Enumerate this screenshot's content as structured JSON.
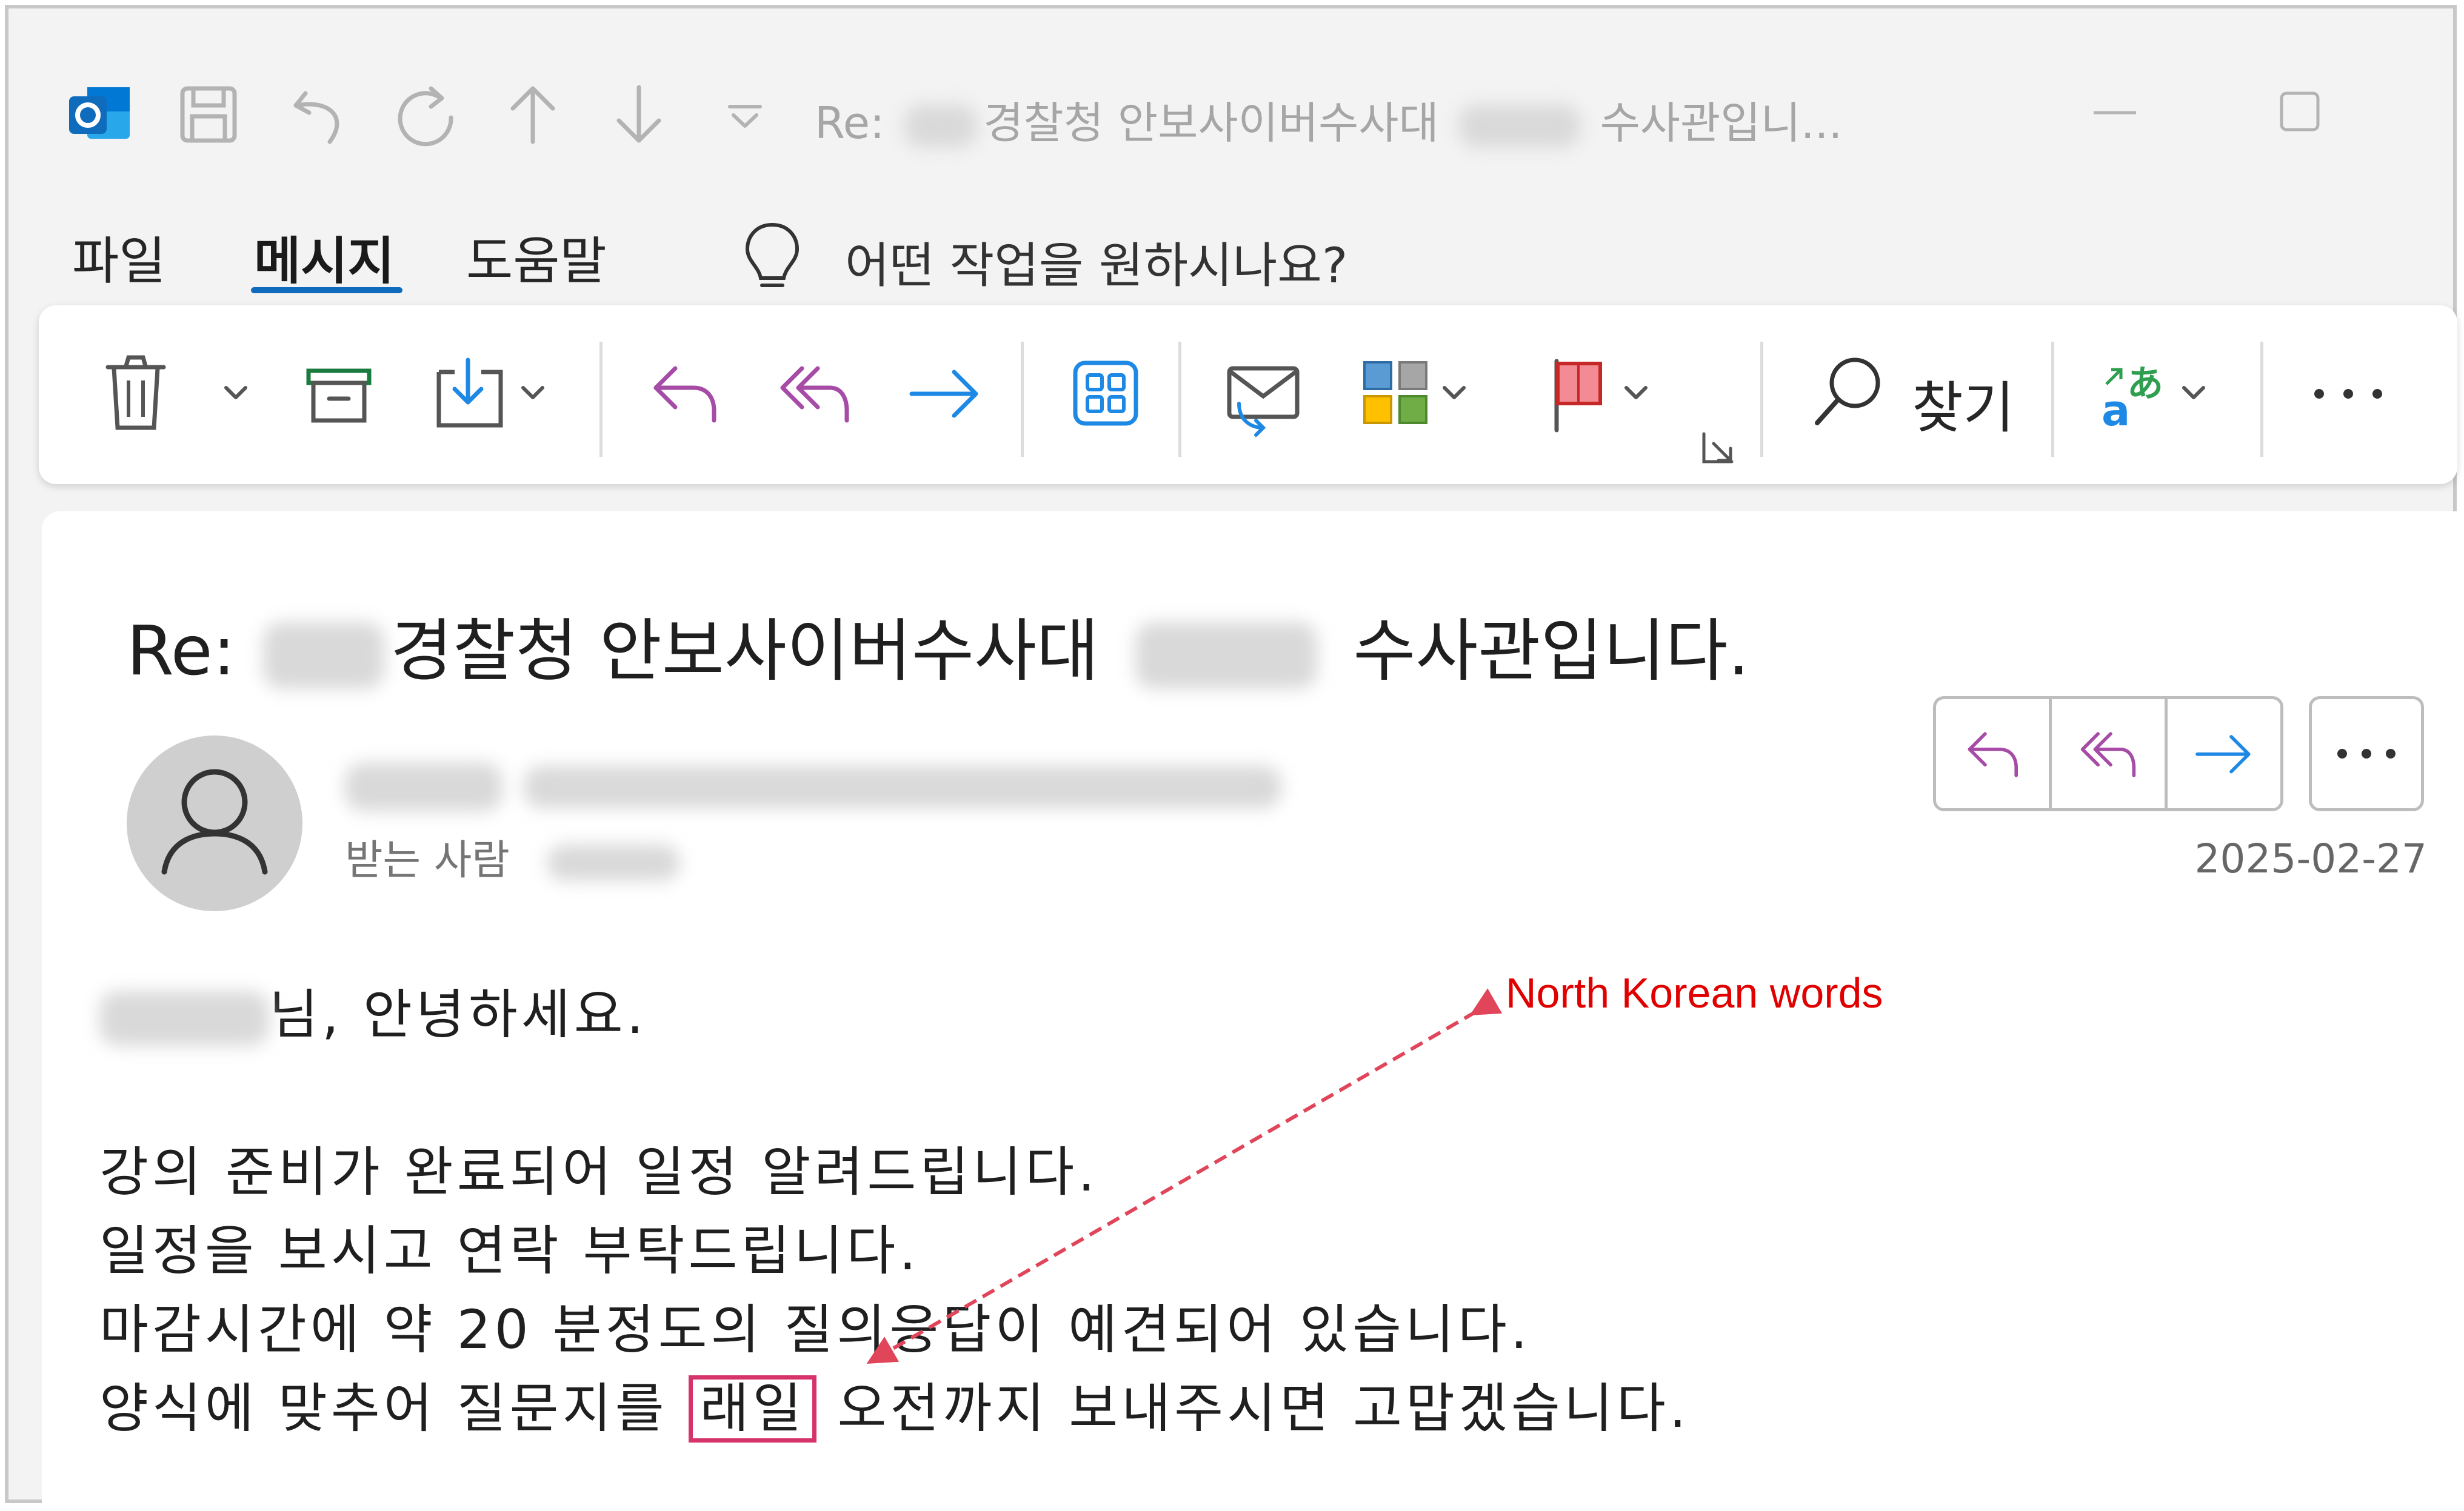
{
  "window": {
    "title_prefix": "Re:",
    "title_mid": "경찰청 안보사이버수사대",
    "title_suffix": "수사관입니..."
  },
  "menu": {
    "items": [
      {
        "label": "파일"
      },
      {
        "label": "메시지"
      },
      {
        "label": "도움말"
      }
    ],
    "tell_me": "어떤 작업을 원하시나요?"
  },
  "ribbon": {
    "find_label": "찾기"
  },
  "email": {
    "subject_prefix": "Re:",
    "subject_mid": "경찰청 안보사이버수사대",
    "subject_suffix": "수사관입니다.",
    "to_label": "받는 사람",
    "date": "2025-02-27",
    "greeting": "님, 안녕하세요.",
    "lines": [
      "강의 준비가 완료되어 일정 알려드립니다.",
      "일정을 보시고 연락 부탁드립니다.",
      "마감시간에 약 20 분정도의 질의응답이 예견되어 있습니다."
    ],
    "last_line_before": "양식에 맞추어 질문지를",
    "last_line_highlight": "래일",
    "last_line_after": "오전까지 보내주시면 고맙겠습니다."
  },
  "annotation": {
    "label": "North Korean words",
    "color": "#e00000"
  },
  "colors": {
    "accent": "#0f6cbd",
    "reply_purple": "#a64ca6",
    "forward_blue": "#1e88e5",
    "highlight_box": "#d6336c"
  }
}
